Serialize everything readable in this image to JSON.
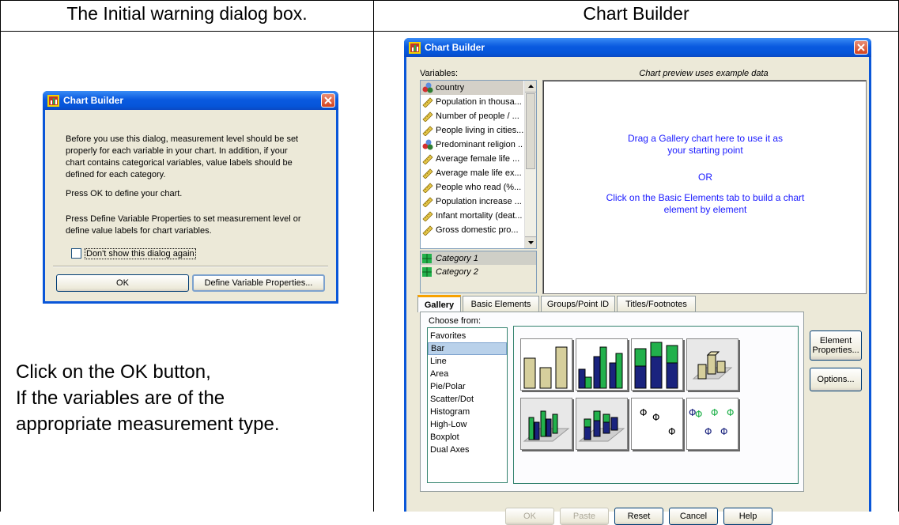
{
  "headers": {
    "left": "The Initial warning dialog box.",
    "right": "Chart Builder"
  },
  "warning_dialog": {
    "title": "Chart Builder",
    "message_p1": "Before you use this dialog, measurement level should be set properly for each variable in your chart. In addition, if your chart contains categorical variables, value labels should be defined for each category.",
    "message_p2": "Press OK to define your chart.",
    "message_p3": "Press Define Variable Properties to set measurement level or define value labels for chart variables.",
    "checkbox_label": "Don't show this dialog again",
    "checkbox_checked": false,
    "ok_label": "OK",
    "define_label": "Define Variable Properties..."
  },
  "instruction": {
    "line1": "Click on the OK button,",
    "line2": "If the variables are of the",
    "line3": "appropriate measurement type."
  },
  "chart_builder": {
    "title": "Chart Builder",
    "variables_label": "Variables:",
    "preview_caption": "Chart preview uses example data",
    "variables": [
      {
        "label": "country",
        "icon": "nominal-icon",
        "selected": true
      },
      {
        "label": "Population in thousa...",
        "icon": "scale-ruler-icon"
      },
      {
        "label": "Number of people / ...",
        "icon": "scale-ruler-icon"
      },
      {
        "label": "People living in cities...",
        "icon": "scale-ruler-icon"
      },
      {
        "label": "Predominant religion ...",
        "icon": "nominal-icon"
      },
      {
        "label": "Average female life ...",
        "icon": "scale-ruler-icon"
      },
      {
        "label": "Average male life ex...",
        "icon": "scale-ruler-icon"
      },
      {
        "label": "People who read (%...",
        "icon": "scale-ruler-icon"
      },
      {
        "label": "Population increase ...",
        "icon": "scale-ruler-icon"
      },
      {
        "label": "Infant mortality (deat...",
        "icon": "scale-ruler-icon"
      },
      {
        "label": "Gross domestic pro...",
        "icon": "scale-ruler-icon"
      }
    ],
    "categories": [
      "Category 1",
      "Category 2"
    ],
    "drop_text_1": "Drag a Gallery chart here to use it as your starting point",
    "drop_or": "OR",
    "drop_text_2": "Click on the Basic Elements tab to build a chart element by element",
    "tabs": [
      "Gallery",
      "Basic Elements",
      "Groups/Point ID",
      "Titles/Footnotes"
    ],
    "active_tab": "Gallery",
    "choose_from_label": "Choose from:",
    "gallery_types": [
      "Favorites",
      "Bar",
      "Line",
      "Area",
      "Pie/Polar",
      "Scatter/Dot",
      "Histogram",
      "High-Low",
      "Boxplot",
      "Dual Axes"
    ],
    "selected_type": "Bar",
    "element_properties_label": "Element Properties...",
    "options_label": "Options...",
    "bottom_buttons": {
      "ok": "OK",
      "paste": "Paste",
      "reset": "Reset",
      "cancel": "Cancel",
      "help": "Help"
    },
    "colors": {
      "tan": "#d6cf9c",
      "navy": "#1a237e",
      "green": "#22b14c",
      "title_blue": "#0a5ae0",
      "drop_text": "#1a1aff"
    }
  }
}
